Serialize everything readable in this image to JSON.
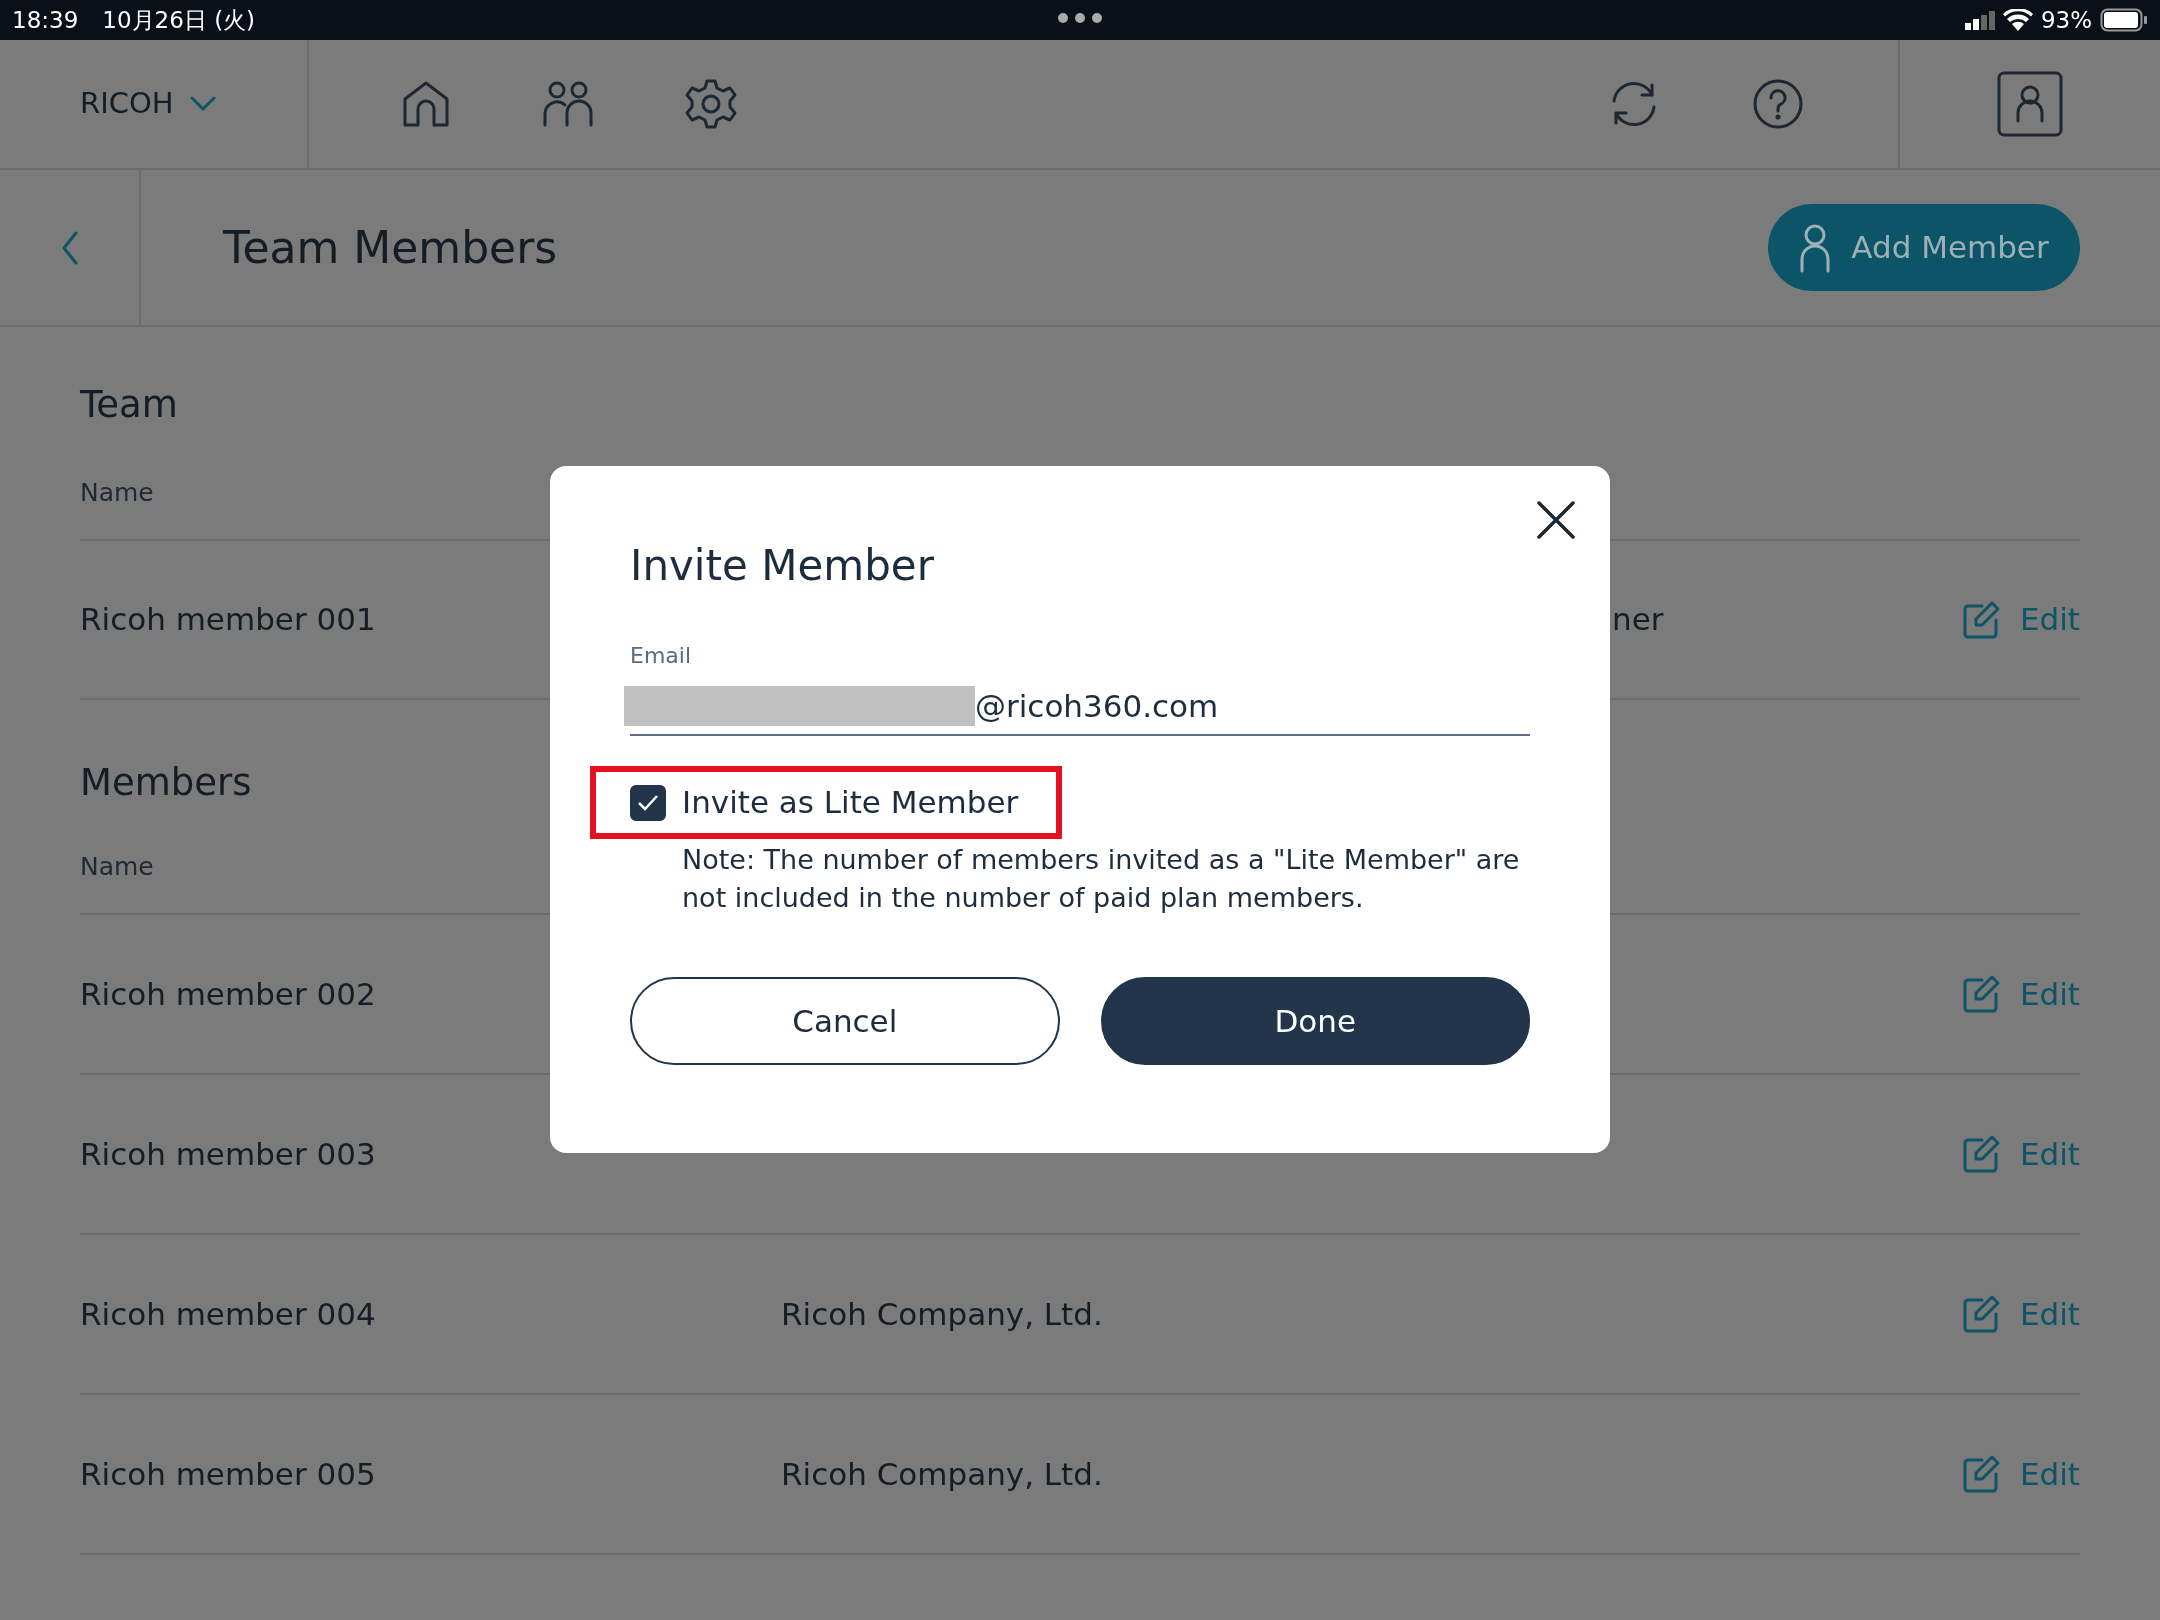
{
  "status_bar": {
    "time": "18:39",
    "date": "10月26日 (火)",
    "battery": "93%"
  },
  "nav": {
    "brand": "RICOH"
  },
  "header": {
    "title": "Team Members",
    "add_button": "Add Member"
  },
  "team": {
    "heading": "Team",
    "column_1": "Name",
    "rows": [
      {
        "name": "Ricoh member 001",
        "column_2": "ner",
        "action": "Edit"
      }
    ]
  },
  "members": {
    "heading": "Members",
    "column_1": "Name",
    "rows": [
      {
        "name": "Ricoh member 002",
        "action": "Edit"
      },
      {
        "name": "Ricoh member 003",
        "action": "Edit"
      },
      {
        "name": "Ricoh member 004",
        "company": "Ricoh Company, Ltd.",
        "action": "Edit"
      },
      {
        "name": "Ricoh member 005",
        "company": "Ricoh Company, Ltd.",
        "action": "Edit"
      }
    ]
  },
  "dialog": {
    "title": "Invite Member",
    "email_label": "Email",
    "email_redacted": true,
    "email_value": "@ricoh360.com",
    "checkbox": {
      "label": "Invite as Lite Member",
      "checked": true,
      "highlighted": true
    },
    "note": "Note: The number of members invited as a \"Lite Member\" are not included in the number of paid plan members.",
    "buttons": [
      {
        "label": "Cancel",
        "kind": "secondary"
      },
      {
        "label": "Done",
        "kind": "primary"
      }
    ]
  }
}
